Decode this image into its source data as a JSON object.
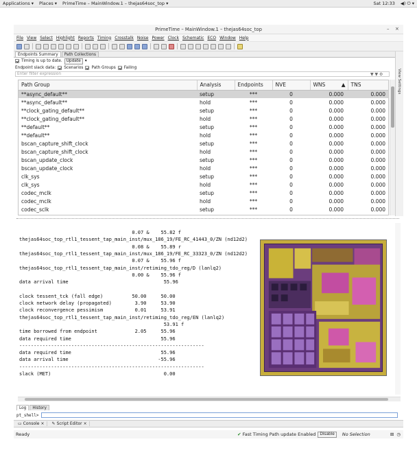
{
  "topbar": {
    "applications": "Applications ▾",
    "places": "Places ▾",
    "app_window": "PrimeTime – MainWindow.1 – thejas64soc_top ▾",
    "clock": "Sat 12:33",
    "sys_icons": "◀) ⏻ ▾"
  },
  "window": {
    "title": "PrimeTime – MainWindow.1 – thejas64soc_top"
  },
  "menu": [
    "File",
    "View",
    "Select",
    "Highlight",
    "Reports",
    "Timing",
    "Crosstalk",
    "Noise",
    "Power",
    "Clock",
    "Schematic",
    "ECO",
    "Window",
    "Help"
  ],
  "tabs": [
    {
      "label": "Endpoints Summary"
    },
    {
      "label": "Path Collections"
    }
  ],
  "status_row": {
    "label": "Timing is up to date.",
    "button": "Update"
  },
  "slack_row": {
    "label": "Endpoint slack data:",
    "opt1": "Scenarios",
    "opt2": "Path Groups",
    "opt3": "Failing"
  },
  "filter": {
    "placeholder": "Enter filter expression"
  },
  "side_panel": {
    "label": "View Settings"
  },
  "table": {
    "headers": [
      "Path Group",
      "Analysis",
      "Endpoints",
      "NVE",
      "WNS",
      "TNS"
    ],
    "rows": [
      [
        "**async_default**",
        "setup",
        "***",
        "0",
        "0.000",
        "0.000"
      ],
      [
        "**async_default**",
        "hold",
        "***",
        "0",
        "0.000",
        "0.000"
      ],
      [
        "**clock_gating_default**",
        "setup",
        "***",
        "0",
        "0.000",
        "0.000"
      ],
      [
        "**clock_gating_default**",
        "hold",
        "***",
        "0",
        "0.000",
        "0.000"
      ],
      [
        "**default**",
        "setup",
        "***",
        "0",
        "0.000",
        "0.000"
      ],
      [
        "**default**",
        "hold",
        "***",
        "0",
        "0.000",
        "0.000"
      ],
      [
        "bscan_capture_shift_clock",
        "setup",
        "***",
        "0",
        "0.000",
        "0.000"
      ],
      [
        "bscan_capture_shift_clock",
        "hold",
        "***",
        "0",
        "0.000",
        "0.000"
      ],
      [
        "bscan_update_clock",
        "setup",
        "***",
        "0",
        "0.000",
        "0.000"
      ],
      [
        "bscan_update_clock",
        "hold",
        "***",
        "0",
        "0.000",
        "0.000"
      ],
      [
        "clk_sys",
        "setup",
        "***",
        "0",
        "0.000",
        "0.000"
      ],
      [
        "clk_sys",
        "hold",
        "***",
        "0",
        "0.000",
        "0.000"
      ],
      [
        "codec_mclk",
        "setup",
        "***",
        "0",
        "0.000",
        "0.000"
      ],
      [
        "codec_mclk",
        "hold",
        "***",
        "0",
        "0.000",
        "0.000"
      ],
      [
        "codec_sclk",
        "setup",
        "***",
        "0",
        "0.000",
        "0.000"
      ]
    ]
  },
  "report": {
    "lines": [
      "                                       0.07 &    55.82 f",
      "thejas64soc_top_rtl1_tessent_tap_main_inst/mux_186_19/FE_RC_41443_0/ZN (nd12d2)",
      "                                       0.08 &    55.89 r",
      "thejas64soc_top_rtl1_tessent_tap_main_inst/mux_186_19/FE_RC_33323_0/ZN (nd12d2)",
      "                                       0.07 &    55.96 f",
      "thejas64soc_top_rtl1_tessent_tap_main_inst/retiming_tdo_reg/D (lanlq2)",
      "                                       0.00 &    55.96 f",
      "data arrival time                                 55.96",
      "",
      "clock tessent_tck (fall edge)          50.00     50.00",
      "clock network delay (propagated)        3.90     53.90",
      "clock reconvergence pessimism           0.01     53.91",
      "thejas64soc_top_rtl1_tessent_tap_main_inst/retiming_tdo_reg/EN (lanlq2)",
      "                                                  53.91 f",
      "time borrowed from endpoint             2.05     55.96",
      "data required time                               55.96",
      "----------------------------------------------------------------",
      "data required time                               55.96",
      "data arrival time                               -55.96",
      "----------------------------------------------------------------",
      "slack (MET)                                       0.00"
    ]
  },
  "log_tabs": [
    "Log",
    "History"
  ],
  "prompt": {
    "label": "pt_shell>"
  },
  "console_tabs": [
    {
      "label": "Console"
    },
    {
      "label": "Script Editor"
    }
  ],
  "statusbar": {
    "ready": "Ready",
    "fast_timing": "Fast Timing Path update Enabled",
    "disable": "Disable",
    "selection": "No Selection"
  }
}
